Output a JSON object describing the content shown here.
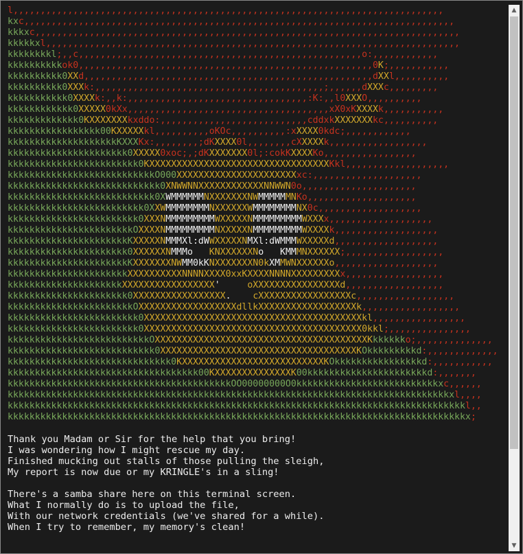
{
  "colors": {
    "terminal_bg": "#1b1b1b",
    "text": "#eeeeee",
    "green": "#78a85a",
    "red": "#c8321e",
    "gold": "#d2a82a",
    "white": "#f0f0f0",
    "scrollbar_track": "#f0f0f0",
    "scrollbar_thumb": "#c1c1c1"
  },
  "art_lines": [
    [
      [
        "r",
        "l,,,,,,,,,,,,,,,,,,,,,,,,,,,,,,,,,,,,,,,,,,,,,,,,,,,,,,,,,,,,,,,,,,,,,,,,,,,,,,,"
      ]
    ],
    [
      [
        "g",
        "kx"
      ],
      [
        "r",
        "c,,,,,,,,,,,,,,,,,,,,,,,,,,,,,,,,,,,,,,,,,,,,,,,,,,,,,,,,,,,,,,,,,,,,,,,,,,,,,,,"
      ]
    ],
    [
      [
        "g",
        "kkkx"
      ],
      [
        "r",
        "c,,,,,,,,,,,,,,,,,,,,,,,,,,,,,,,,,,,,,,,,,,,,,,,,,,,,,,,,,,,,,,,,,,,,,,,,,,,,,,"
      ]
    ],
    [
      [
        "g",
        "kkkkkx"
      ],
      [
        "r",
        "l,,,,,,,,,,,,,,,,,,,,,,,,,,,,,,,,,,,,,,,,,,,,,,,,,,,,,,,,,,,,,,,,,,,,,,,,,,,,"
      ]
    ],
    [
      [
        "g",
        "kkkkkkkkl"
      ],
      [
        "r",
        ";,,c,,,,,,,,,,,,,,,,,,,,,,,,,,,,,,,,,,,,,,,,,,,,,,,,,,,,o:,,,,,,,,,,,,"
      ]
    ],
    [
      [
        "g",
        "kkkkkkkkkk"
      ],
      [
        "r",
        "ok0,,,,,,,,,,,,,,,,,,,,,,,,,,,,,,,,,,,,,,,,,,,,,,,,,,,,,,0"
      ],
      [
        "y",
        "K"
      ],
      [
        "r",
        ";,,,,,,,,,,,"
      ]
    ],
    [
      [
        "g",
        "kkkkkkkkkk0"
      ],
      [
        "y",
        "XX"
      ],
      [
        "r",
        "d,,,,,,,,,,,,,,,,,,,,,,,,,,,,,,,,,,,,,,,,,,,,,,,,,,,,,d"
      ],
      [
        "y",
        "XX"
      ],
      [
        "r",
        "l,,,,,,,,,,"
      ]
    ],
    [
      [
        "g",
        "kkkkkkkkkk0"
      ],
      [
        "y",
        "XXX"
      ],
      [
        "r",
        "k:,,,,,,,,,,,,,,,,,,,,,,,,,,,,,,,,,,,,,,,,,,;,,,,,,d"
      ],
      [
        "y",
        "XXX"
      ],
      [
        "r",
        "c,,,,,,,,,"
      ]
    ],
    [
      [
        "g",
        "kkkkkkkkkkk0"
      ],
      [
        "y",
        "XXXX"
      ],
      [
        "r",
        "k:,,k:,,,,,,,,,,,,,,,,,,,,,,,,,,,,,,,,,:K:,,l0"
      ],
      [
        "y",
        "XXX"
      ],
      [
        "r",
        "O,,,,,,,,,,"
      ]
    ],
    [
      [
        "g",
        "kkkkkkkkkkkk0"
      ],
      [
        "y",
        "XXXXX"
      ],
      [
        "r",
        "0kXx,,,,,,,,,,,,,,,,,,,,,,,,,,,,,,,,,,,,,xX0xK"
      ],
      [
        "y",
        "XXXX"
      ],
      [
        "r",
        "k,,,,,,,,,,,"
      ]
    ],
    [
      [
        "g",
        "kkkkkkkkkkkkk0"
      ],
      [
        "y",
        "KXXXXXXX"
      ],
      [
        "r",
        "kxddo:,,,,,,,,,,,,,,,,,,,,,,,,,,,cddxk"
      ],
      [
        "y",
        "XXXXXXX"
      ],
      [
        "r",
        "kc,,,,,,,,,,"
      ]
    ],
    [
      [
        "g",
        "kkkkkkkkkkkkkkkkk00"
      ],
      [
        "y",
        "KXXXXX"
      ],
      [
        "r",
        "kl,,,,,,,,,,oKOc,,,,,,,,,,:x"
      ],
      [
        "y",
        "XXXX"
      ],
      [
        "r",
        "0kdc;,,,,,,,,,,,,"
      ]
    ],
    [
      [
        "g",
        "kkkkkkkkkkkkkkkkkkkkKXXX"
      ],
      [
        "r",
        "Kx:,,,,,,,,;dK"
      ],
      [
        "y",
        "XXXX"
      ],
      [
        "r",
        "0l,,,,,,,,cX"
      ],
      [
        "y",
        "XXXX"
      ],
      [
        "r",
        "k,,,,,,,,,,,,,,,,,,"
      ]
    ],
    [
      [
        "g",
        "kkkkkkkkkkkkkkkkkkkkkk0"
      ],
      [
        "y",
        "XXXXX"
      ],
      [
        "r",
        "0xoc;,;dK"
      ],
      [
        "y",
        "XXXXXXX"
      ],
      [
        "r",
        "0l;:cokK"
      ],
      [
        "y",
        "XXXX"
      ],
      [
        "r",
        "Ko,,,,,,,,,,,,,,,,,"
      ]
    ],
    [
      [
        "g",
        "kkkkkkkkkkkkkkkkkkkkkkkk0"
      ],
      [
        "y",
        "KXXXXXXXXXXXXXXXXXXXXXXXXXXXXXXXXX"
      ],
      [
        "r",
        "Kkl,,,,,,,,,,,,,,,,,,,"
      ]
    ],
    [
      [
        "g",
        "kkkkkkkkkkkkkkkkkkkkkkkkkkkO000"
      ],
      [
        "y",
        "XXXXXXXXXXXXXXXXXXXXXX"
      ],
      [
        "r",
        "xc:,,,,,,,,,,,,,,,,,,,,"
      ]
    ],
    [
      [
        "g",
        "kkkkkkkkkkkkkkkkkkkkkkkkkkkk0"
      ],
      [
        "y",
        "XNWWNN"
      ],
      [
        "y",
        "XXXXXXXXXXXX"
      ],
      [
        "y",
        "NNWWN"
      ],
      [
        "r",
        "0o,,,,,,,,,,,,,,,,,,,,,"
      ]
    ],
    [
      [
        "g",
        "kkkkkkkkkkkkkkkkkkkkkkkkkkk0X"
      ],
      [
        "w",
        "WMMMMMM"
      ],
      [
        "y",
        "NXXXXXXXNW"
      ],
      [
        "w",
        "MMMMM"
      ],
      [
        "y",
        "MN"
      ],
      [
        "r",
        "Ko,,,,,,,,,,,,,,,,,,,,"
      ]
    ],
    [
      [
        "g",
        "kkkkkkkkkkkkkkkkkkkkkkkkk0X"
      ],
      [
        "y",
        "XW"
      ],
      [
        "w",
        "MMMMMMMM"
      ],
      [
        "y",
        "NXXXXXXW"
      ],
      [
        "w",
        "MMMMMMMM"
      ],
      [
        "y",
        "NX"
      ],
      [
        "r",
        "0c,,,,,,,,,,,,,,,,,,,"
      ]
    ],
    [
      [
        "g",
        "kkkkkkkkkkkkkkkkkkkkkkkk0"
      ],
      [
        "y",
        "XXXN"
      ],
      [
        "w",
        "MMMMMMMMM"
      ],
      [
        "y",
        "WXXXXXN"
      ],
      [
        "w",
        "MMMMMMMMM"
      ],
      [
        "y",
        "WXXX"
      ],
      [
        "r",
        "x,,,,,,,,,,,,,,,,,,,"
      ]
    ],
    [
      [
        "g",
        "kkkkkkkkkkkkkkkkkkkkkkkO"
      ],
      [
        "y",
        "XXXXN"
      ],
      [
        "w",
        "MMMMMMMMM"
      ],
      [
        "y",
        "NXXXXXN"
      ],
      [
        "w",
        "MMMMMMMMM"
      ],
      [
        "y",
        "WXXXX"
      ],
      [
        "r",
        "k,,,,,,,,,,,,,,,,,,,"
      ]
    ],
    [
      [
        "g",
        "kkkkkkkkkkkkkkkkkkkkkkK"
      ],
      [
        "y",
        "XXXXXN"
      ],
      [
        "w",
        "MMMXl:dW"
      ],
      [
        "y",
        "WXXXXXN"
      ],
      [
        "w",
        "MXl:dWMMM"
      ],
      [
        "y",
        "WXXXXXd"
      ],
      [
        "r",
        ",,,,,,,,,,,,,,,,,,,"
      ]
    ],
    [
      [
        "g",
        "kkkkkkkkkkkkkkkkkkkkkk0"
      ],
      [
        "y",
        "XXXXXXN"
      ],
      [
        "w",
        "MMMo   "
      ],
      [
        "y",
        "KNXXXXXXN"
      ],
      [
        "w",
        "o   KMM"
      ],
      [
        "y",
        "MNXXXXXX"
      ],
      [
        "r",
        ";,,,,,,,,,,,,,,,,,,"
      ]
    ],
    [
      [
        "g",
        "kkkkkkkkkkkkkkkkkkkkkkK"
      ],
      [
        "y",
        "XXXXXXXNW"
      ],
      [
        "w",
        "MM0kK"
      ],
      [
        "y",
        "NXXXXXXXN0k"
      ],
      [
        "w",
        "XM"
      ],
      [
        "y",
        "MWNXXXXXXo"
      ],
      [
        "r",
        ",,,,,,,,,,,,,,,,,,,"
      ]
    ],
    [
      [
        "g",
        "kkkkkkkkkkkkkkkkkkkkkk"
      ],
      [
        "y",
        "XXXXXXXXXXNNNNXXXX0xxKXXXXNNNNXXXXXXXXX"
      ],
      [
        "r",
        "x,,,,,,,,,,,,,,,,,,"
      ]
    ],
    [
      [
        "g",
        "kkkkkkkkkkkkkkkkkkkkk"
      ],
      [
        "y",
        "XXXXXXXXXXXXXXXXX"
      ],
      [
        "w",
        "'     "
      ],
      [
        "y",
        "oXXXXXXXXXXXXXXXXd"
      ],
      [
        "r",
        ",,,,,,,,,,,,,,,,,,"
      ]
    ],
    [
      [
        "g",
        "kkkkkkkkkkkkkkkkkkkkkk0"
      ],
      [
        "y",
        "XXXXXXXXXXXXXXXXX"
      ],
      [
        "w",
        ".    "
      ],
      [
        "y",
        "cXXXXXXXXXXXXXXXXXc"
      ],
      [
        "r",
        ",,,,,,,,,,,,,,,,,,"
      ]
    ],
    [
      [
        "g",
        "kkkkkkkkkkkkkkkkkkkkkkkO"
      ],
      [
        "y",
        "XXXXXXXXXXXXXXXXXXdllkXXXXXXXXXXXXXXXXXXk"
      ],
      [
        "r",
        ",,,,,,,,,,,,,,,,,,"
      ]
    ],
    [
      [
        "g",
        "kkkkkkkkkkkkkkkkkkkkkkkk0"
      ],
      [
        "y",
        "XXXXXXXXXXXXXXXXXXXXXXXXXXXXXXXXXXXXXXXXkl"
      ],
      [
        "r",
        ",,,,,,,,,,,,,,,,,"
      ]
    ],
    [
      [
        "g",
        "kkkkkkkkkkkkkkkkkkkkkkkk0"
      ],
      [
        "y",
        "XXXXXXXXXXXXXXXXXXXXXXXXXXXXXXXXXXXXXXXX0kkl"
      ],
      [
        "r",
        ";,,,,,,,,,,,,,,,"
      ]
    ],
    [
      [
        "g",
        "kkkkkkkkkkkkkkkkkkkkkkkkkkO"
      ],
      [
        "y",
        "XXXXXXXXXXXXXXXXXXXXXXXXXXXXXXXXXXXXXXXK"
      ],
      [
        "g",
        "kkkkkk"
      ],
      [
        "r",
        "o;,,,,,,,,,,,,,,"
      ]
    ],
    [
      [
        "g",
        "kkkkkkkkkkkkkkkkkkkkkkkkkkk0"
      ],
      [
        "y",
        "XXXXXXXXXXXXXXXXXXXXXXXXXXXXXXXXXXXXK"
      ],
      [
        "g",
        "Okkkkkkkkkd"
      ],
      [
        "r",
        ":,,,,,,,,,,,,,"
      ]
    ],
    [
      [
        "g",
        "kkkkkkkkkkkkkkkkkkkkkkkkkkkkkk0"
      ],
      [
        "y",
        "KXXXXXXXXXXXXXXXXXXXXXXXXXXK"
      ],
      [
        "g",
        "Okkkkkkkkkkkkkkkkd"
      ],
      [
        "r",
        ":,,,,,,,,,,,"
      ]
    ],
    [
      [
        "g",
        "kkkkkkkkkkkkkkkkkkkkkkkkkkkkkkkkkkk00"
      ],
      [
        "y",
        "KXXXXXXXXXXXXXXK"
      ],
      [
        "g",
        "00kkkkkkkkkkkkkkkkkkkkkkd"
      ],
      [
        "r",
        ":,,,,,,,"
      ]
    ],
    [
      [
        "g",
        "kkkkkkkkkkkkkkkkkkkkkkkkkkkkkkkkkkkkkkkkkOO00000000O0kkkkkkkkkkkkkkkkkkkkkkkkkkx"
      ],
      [
        "r",
        "c,,,,,,"
      ]
    ],
    [
      [
        "g",
        "kkkkkkkkkkkkkkkkkkkkkkkkkkkkkkkkkkkkkkkkkkkkkkkkkkkkkkkkkkkkkkkkkkkkkkkkkkkkkkkkkx"
      ],
      [
        "r",
        "l,,,,"
      ]
    ],
    [
      [
        "g",
        "kkkkkkkkkkkkkkkkkkkkkkkkkkkkkkkkkkkkkkkkkkkkkkkkkkkkkkkkkkkkkkkkkkkkkkkkkkkkkkkkkkkk"
      ],
      [
        "r",
        "l,,"
      ]
    ],
    [
      [
        "g",
        "kkkkkkkkkkkkkkkkkkkkkkkkkkkkkkkkkkkkkkkkkkkkkkkkkkkkkkkkkkkkkkkkkkkkkkkkkkkkkkkkkkkkx"
      ],
      [
        "r",
        ";"
      ]
    ]
  ],
  "poem": {
    "stanza1": [
      "Thank you Madam or Sir for the help that you bring!",
      "I was wondering how I might rescue my day.",
      "Finished mucking out stalls of those pulling the sleigh,",
      "My report is now due or my KRINGLE's in a sling!"
    ],
    "stanza2": [
      "There's a samba share here on this terminal screen.",
      "What I normally do is to upload the file,",
      "With our network credentials (we've shared for a while).",
      "When I try to remember, my memory's clean!"
    ]
  },
  "scrollbar": {
    "up_arrow": "▲",
    "down_arrow": "▼"
  }
}
